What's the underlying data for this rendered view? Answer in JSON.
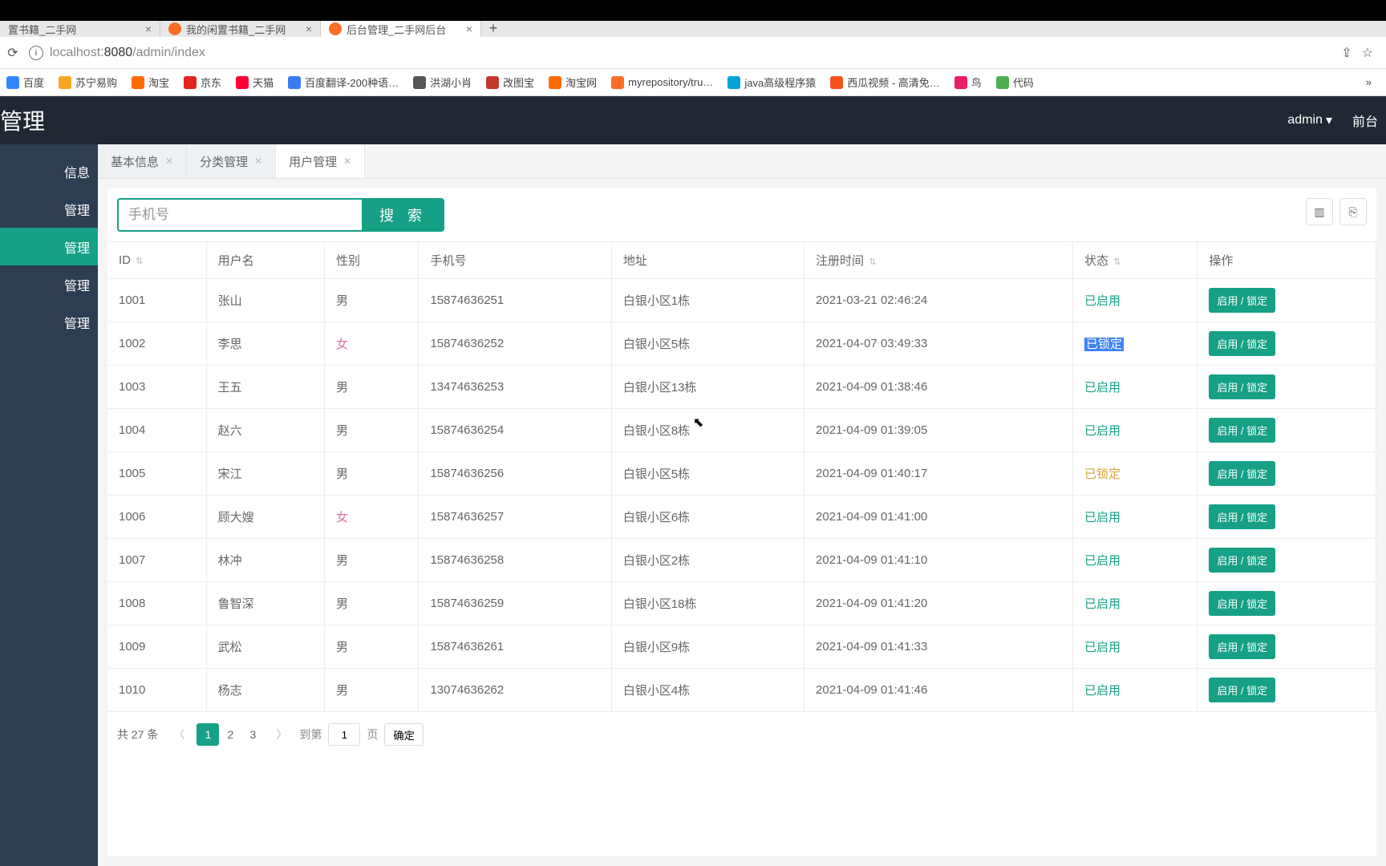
{
  "browser": {
    "tabs": [
      {
        "title": "置书籍_二手网"
      },
      {
        "title": "我的闲置书籍_二手网"
      },
      {
        "title": "后台管理_二手网后台"
      }
    ],
    "url_host": "localhost:",
    "url_port": "8080",
    "url_path": "/admin/index"
  },
  "bookmarks": [
    {
      "label": "百度",
      "color": "#3385ff"
    },
    {
      "label": "苏宁易购",
      "color": "#f6a623"
    },
    {
      "label": "淘宝",
      "color": "#ff6a00"
    },
    {
      "label": "京东",
      "color": "#e1251b"
    },
    {
      "label": "天猫",
      "color": "#ff0036"
    },
    {
      "label": "百度翻译-200种语…",
      "color": "#3a7bf0"
    },
    {
      "label": "洪湖小肖",
      "color": "#555"
    },
    {
      "label": "改图宝",
      "color": "#c0392b"
    },
    {
      "label": "淘宝网",
      "color": "#ff6a00"
    },
    {
      "label": "myrepository/tru…",
      "color": "#fc6d26"
    },
    {
      "label": "java高级程序猿",
      "color": "#00a1d6"
    },
    {
      "label": "西瓜视频 - 高清免…",
      "color": "#f4511e"
    },
    {
      "label": "鸟",
      "color": "#e91e63"
    },
    {
      "label": "代码",
      "color": "#4caf50"
    }
  ],
  "header": {
    "title": "管理",
    "user": "admin",
    "frontend": "前台"
  },
  "sidebar": {
    "items": [
      "信息",
      "管理",
      "管理",
      "管理",
      "管理"
    ],
    "activeIndex": 2
  },
  "contentTabs": [
    {
      "label": "基本信息"
    },
    {
      "label": "分类管理"
    },
    {
      "label": "用户管理"
    }
  ],
  "search": {
    "placeholder": "手机号",
    "button": "搜 索"
  },
  "table": {
    "headers": [
      "ID",
      "用户名",
      "性别",
      "手机号",
      "地址",
      "注册时间",
      "状态",
      "操作"
    ],
    "opLabel": "启用 / 锁定",
    "rows": [
      {
        "id": "1001",
        "name": "张山",
        "gender": "男",
        "phone": "15874636251",
        "addr": "白银小区1栋",
        "time": "2021-03-21 02:46:24",
        "status": "已启用",
        "statusType": "enabled"
      },
      {
        "id": "1002",
        "name": "李思",
        "gender": "女",
        "phone": "15874636252",
        "addr": "白银小区5栋",
        "time": "2021-04-07 03:49:33",
        "status": "已锁定",
        "statusType": "locked-hl"
      },
      {
        "id": "1003",
        "name": "王五",
        "gender": "男",
        "phone": "13474636253",
        "addr": "白银小区13栋",
        "time": "2021-04-09 01:38:46",
        "status": "已启用",
        "statusType": "enabled"
      },
      {
        "id": "1004",
        "name": "赵六",
        "gender": "男",
        "phone": "15874636254",
        "addr": "白银小区8栋",
        "time": "2021-04-09 01:39:05",
        "status": "已启用",
        "statusType": "enabled"
      },
      {
        "id": "1005",
        "name": "宋江",
        "gender": "男",
        "phone": "15874636256",
        "addr": "白银小区5栋",
        "time": "2021-04-09 01:40:17",
        "status": "已锁定",
        "statusType": "locked"
      },
      {
        "id": "1006",
        "name": "顾大嫂",
        "gender": "女",
        "phone": "15874636257",
        "addr": "白银小区6栋",
        "time": "2021-04-09 01:41:00",
        "status": "已启用",
        "statusType": "enabled"
      },
      {
        "id": "1007",
        "name": "林冲",
        "gender": "男",
        "phone": "15874636258",
        "addr": "白银小区2栋",
        "time": "2021-04-09 01:41:10",
        "status": "已启用",
        "statusType": "enabled"
      },
      {
        "id": "1008",
        "name": "鲁智深",
        "gender": "男",
        "phone": "15874636259",
        "addr": "白银小区18栋",
        "time": "2021-04-09 01:41:20",
        "status": "已启用",
        "statusType": "enabled"
      },
      {
        "id": "1009",
        "name": "武松",
        "gender": "男",
        "phone": "15874636261",
        "addr": "白银小区9栋",
        "time": "2021-04-09 01:41:33",
        "status": "已启用",
        "statusType": "enabled"
      },
      {
        "id": "1010",
        "name": "杨志",
        "gender": "男",
        "phone": "13074636262",
        "addr": "白银小区4栋",
        "time": "2021-04-09 01:41:46",
        "status": "已启用",
        "statusType": "enabled"
      }
    ]
  },
  "pager": {
    "total": "共 27 条",
    "pages": [
      "1",
      "2",
      "3"
    ],
    "goto": "到第",
    "gotoValue": "1",
    "pageLabel": "页",
    "confirm": "确定"
  }
}
